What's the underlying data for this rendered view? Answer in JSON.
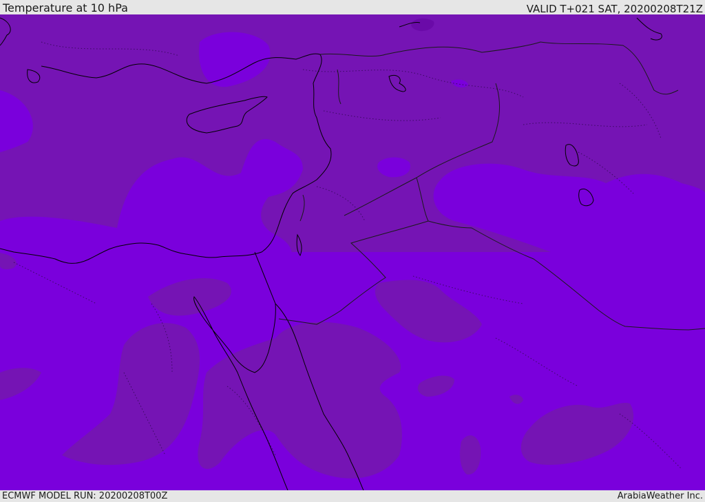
{
  "header": {
    "title": "Temperature at 10 hPa",
    "valid_time": "VALID T+021 SAT, 20200208T21Z"
  },
  "footer": {
    "model_run": "ECMWF MODEL RUN: 20200208T00Z",
    "credit": "ArabiaWeather Inc."
  },
  "map": {
    "colors": {
      "field_bright": "#7a00dc",
      "field_dark": "#7514b4",
      "field_darkest": "#6a0aa8",
      "coastline": "#000000",
      "border": "#1a1a1a"
    }
  }
}
